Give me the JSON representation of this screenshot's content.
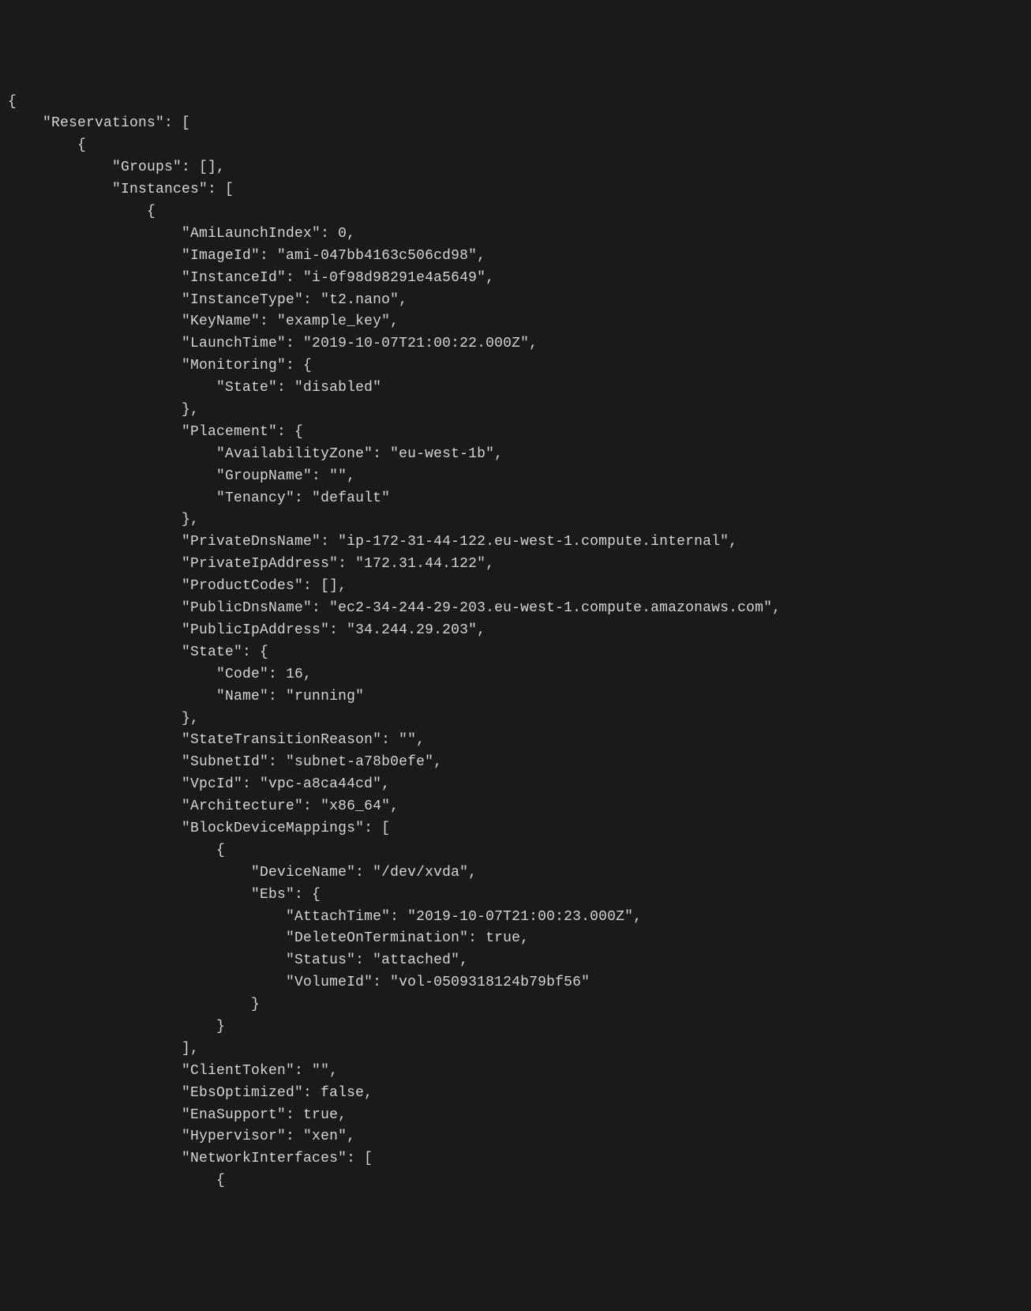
{
  "json_output": {
    "Reservations": [
      {
        "Groups": [],
        "Instances": [
          {
            "AmiLaunchIndex": 0,
            "ImageId": "ami-047bb4163c506cd98",
            "InstanceId": "i-0f98d98291e4a5649",
            "InstanceType": "t2.nano",
            "KeyName": "example_key",
            "LaunchTime": "2019-10-07T21:00:22.000Z",
            "Monitoring": {
              "State": "disabled"
            },
            "Placement": {
              "AvailabilityZone": "eu-west-1b",
              "GroupName": "",
              "Tenancy": "default"
            },
            "PrivateDnsName": "ip-172-31-44-122.eu-west-1.compute.internal",
            "PrivateIpAddress": "172.31.44.122",
            "ProductCodes": [],
            "PublicDnsName": "ec2-34-244-29-203.eu-west-1.compute.amazonaws.com",
            "PublicIpAddress": "34.244.29.203",
            "State": {
              "Code": 16,
              "Name": "running"
            },
            "StateTransitionReason": "",
            "SubnetId": "subnet-a78b0efe",
            "VpcId": "vpc-a8ca44cd",
            "Architecture": "x86_64",
            "BlockDeviceMappings": [
              {
                "DeviceName": "/dev/xvda",
                "Ebs": {
                  "AttachTime": "2019-10-07T21:00:23.000Z",
                  "DeleteOnTermination": true,
                  "Status": "attached",
                  "VolumeId": "vol-0509318124b79bf56"
                }
              }
            ],
            "ClientToken": "",
            "EbsOptimized": false,
            "EnaSupport": true,
            "Hypervisor": "xen",
            "NetworkInterfaces_opener": "["
          }
        ]
      }
    ]
  },
  "rendered_text": "{\n    \"Reservations\": [\n        {\n            \"Groups\": [],\n            \"Instances\": [\n                {\n                    \"AmiLaunchIndex\": 0,\n                    \"ImageId\": \"ami-047bb4163c506cd98\",\n                    \"InstanceId\": \"i-0f98d98291e4a5649\",\n                    \"InstanceType\": \"t2.nano\",\n                    \"KeyName\": \"example_key\",\n                    \"LaunchTime\": \"2019-10-07T21:00:22.000Z\",\n                    \"Monitoring\": {\n                        \"State\": \"disabled\"\n                    },\n                    \"Placement\": {\n                        \"AvailabilityZone\": \"eu-west-1b\",\n                        \"GroupName\": \"\",\n                        \"Tenancy\": \"default\"\n                    },\n                    \"PrivateDnsName\": \"ip-172-31-44-122.eu-west-1.compute.internal\",\n                    \"PrivateIpAddress\": \"172.31.44.122\",\n                    \"ProductCodes\": [],\n                    \"PublicDnsName\": \"ec2-34-244-29-203.eu-west-1.compute.amazonaws.com\",\n                    \"PublicIpAddress\": \"34.244.29.203\",\n                    \"State\": {\n                        \"Code\": 16,\n                        \"Name\": \"running\"\n                    },\n                    \"StateTransitionReason\": \"\",\n                    \"SubnetId\": \"subnet-a78b0efe\",\n                    \"VpcId\": \"vpc-a8ca44cd\",\n                    \"Architecture\": \"x86_64\",\n                    \"BlockDeviceMappings\": [\n                        {\n                            \"DeviceName\": \"/dev/xvda\",\n                            \"Ebs\": {\n                                \"AttachTime\": \"2019-10-07T21:00:23.000Z\",\n                                \"DeleteOnTermination\": true,\n                                \"Status\": \"attached\",\n                                \"VolumeId\": \"vol-0509318124b79bf56\"\n                            }\n                        }\n                    ],\n                    \"ClientToken\": \"\",\n                    \"EbsOptimized\": false,\n                    \"EnaSupport\": true,\n                    \"Hypervisor\": \"xen\",\n                    \"NetworkInterfaces\": [\n                        {"
}
